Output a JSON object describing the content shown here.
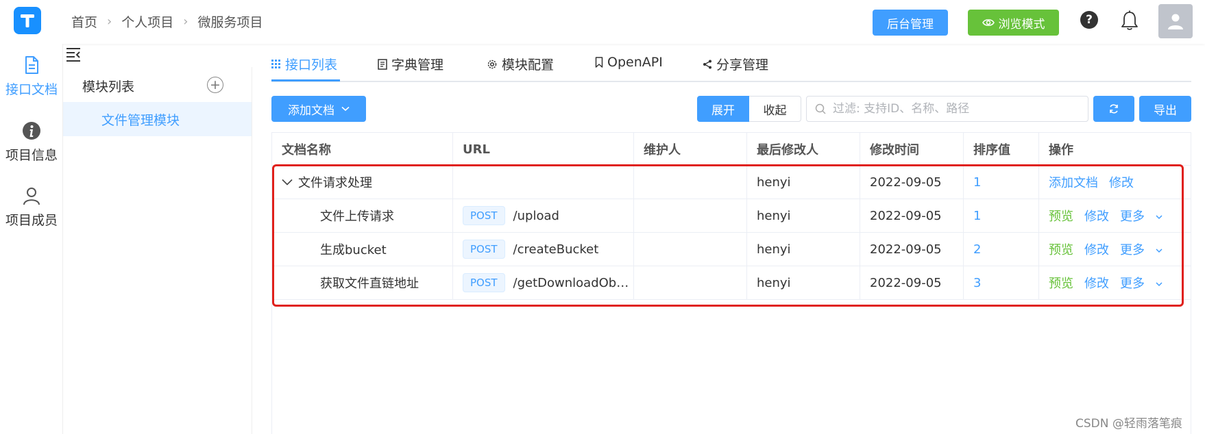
{
  "breadcrumb": [
    "首页",
    "个人项目",
    "微服务项目"
  ],
  "header": {
    "admin_label": "后台管理",
    "browse_label": "浏览模式",
    "help_glyph": "?"
  },
  "leftnav": {
    "items": [
      {
        "label": "接口文档",
        "icon": "document-icon",
        "active": true
      },
      {
        "label": "项目信息",
        "icon": "info-icon",
        "active": false
      },
      {
        "label": "项目成员",
        "icon": "user-icon",
        "active": false
      }
    ]
  },
  "modules": {
    "header": "模块列表",
    "add_glyph": "+",
    "items": [
      "文件管理模块"
    ]
  },
  "tabs": [
    {
      "label": "接口列表",
      "icon": "grid-icon",
      "active": true
    },
    {
      "label": "字典管理",
      "icon": "doc-list-icon",
      "active": false
    },
    {
      "label": "模块配置",
      "icon": "gear-icon",
      "active": false
    },
    {
      "label": "OpenAPI",
      "icon": "bookmark-icon",
      "active": false
    },
    {
      "label": "分享管理",
      "icon": "share-icon",
      "active": false
    }
  ],
  "toolbar": {
    "add_doc_label": "添加文档",
    "expand_label": "展开",
    "collapse_label": "收起",
    "search_placeholder": "过滤: 支持ID、名称、路径",
    "export_label": "导出"
  },
  "table": {
    "columns": [
      "文档名称",
      "URL",
      "维护人",
      "最后修改人",
      "修改时间",
      "排序值",
      "操作"
    ],
    "group": {
      "name": "文件请求处理",
      "modifier": "henyi",
      "time": "2022-09-05",
      "order": "1",
      "actions": [
        "添加文档",
        "修改"
      ]
    },
    "rows": [
      {
        "name": "文件上传请求",
        "method": "POST",
        "path": "/upload",
        "modifier": "henyi",
        "time": "2022-09-05",
        "order": "1",
        "actions": [
          "预览",
          "修改",
          "更多"
        ]
      },
      {
        "name": "生成bucket",
        "method": "POST",
        "path": "/createBucket",
        "modifier": "henyi",
        "time": "2022-09-05",
        "order": "2",
        "actions": [
          "预览",
          "修改",
          "更多"
        ]
      },
      {
        "name": "获取文件直链地址",
        "method": "POST",
        "path": "/getDownloadOb…",
        "modifier": "henyi",
        "time": "2022-09-05",
        "order": "3",
        "actions": [
          "预览",
          "修改",
          "更多"
        ]
      }
    ]
  },
  "watermark": "CSDN @轻雨落笔痕",
  "colors": {
    "primary": "#409eff",
    "success": "#67c23a",
    "highlight": "#e0201b"
  }
}
